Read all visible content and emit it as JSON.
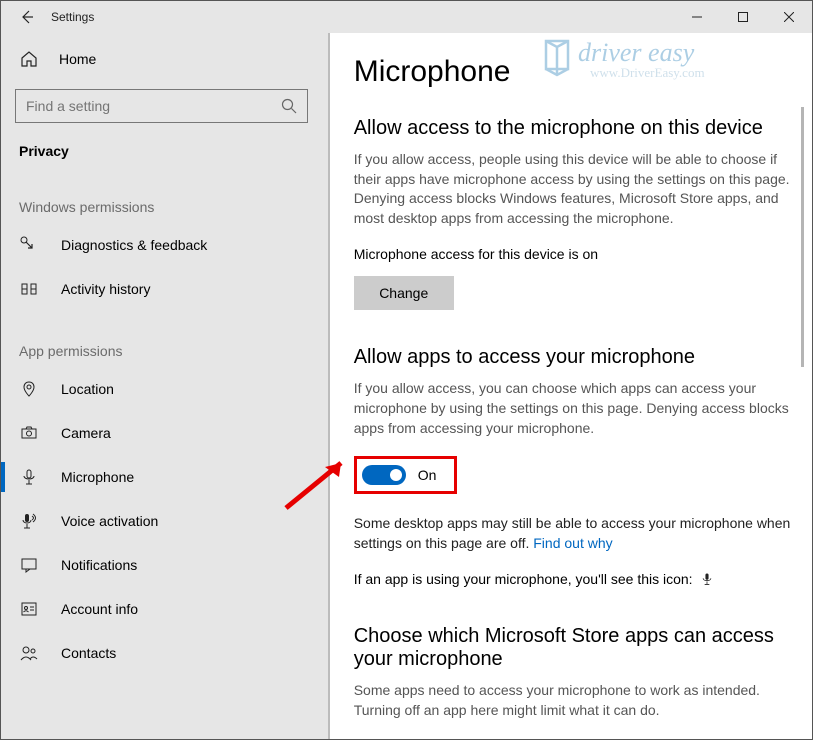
{
  "titlebar": {
    "title": "Settings"
  },
  "sidebar": {
    "home": "Home",
    "search_placeholder": "Find a setting",
    "current_page": "Privacy",
    "group_windows": "Windows permissions",
    "group_app": "App permissions",
    "windows_items": [
      {
        "label": "Diagnostics & feedback"
      },
      {
        "label": "Activity history"
      }
    ],
    "app_items": [
      {
        "label": "Location"
      },
      {
        "label": "Camera"
      },
      {
        "label": "Microphone"
      },
      {
        "label": "Voice activation"
      },
      {
        "label": "Notifications"
      },
      {
        "label": "Account info"
      },
      {
        "label": "Contacts"
      }
    ]
  },
  "main": {
    "page_title": "Microphone",
    "section1_title": "Allow access to the microphone on this device",
    "section1_desc": "If you allow access, people using this device will be able to choose if their apps have microphone access by using the settings on this page. Denying access blocks Windows features, Microsoft Store apps, and most desktop apps from accessing the microphone.",
    "device_status": "Microphone access for this device is on",
    "change_label": "Change",
    "section2_title": "Allow apps to access your microphone",
    "section2_desc": "If you allow access, you can choose which apps can access your microphone by using the settings on this page. Denying access blocks apps from accessing your microphone.",
    "toggle_label": "On",
    "desktop_note_1": "Some desktop apps may still be able to access your microphone when settings on this page are off. ",
    "desktop_note_link": "Find out why",
    "icon_line": "If an app is using your microphone, you'll see this icon:",
    "section3_title": "Choose which Microsoft Store apps can access your microphone",
    "section3_desc": "Some apps need to access your microphone to work as intended. Turning off an app here might limit what it can do."
  },
  "watermark": {
    "brand_main": "driver easy",
    "brand_url": "www.DriverEasy.com"
  }
}
